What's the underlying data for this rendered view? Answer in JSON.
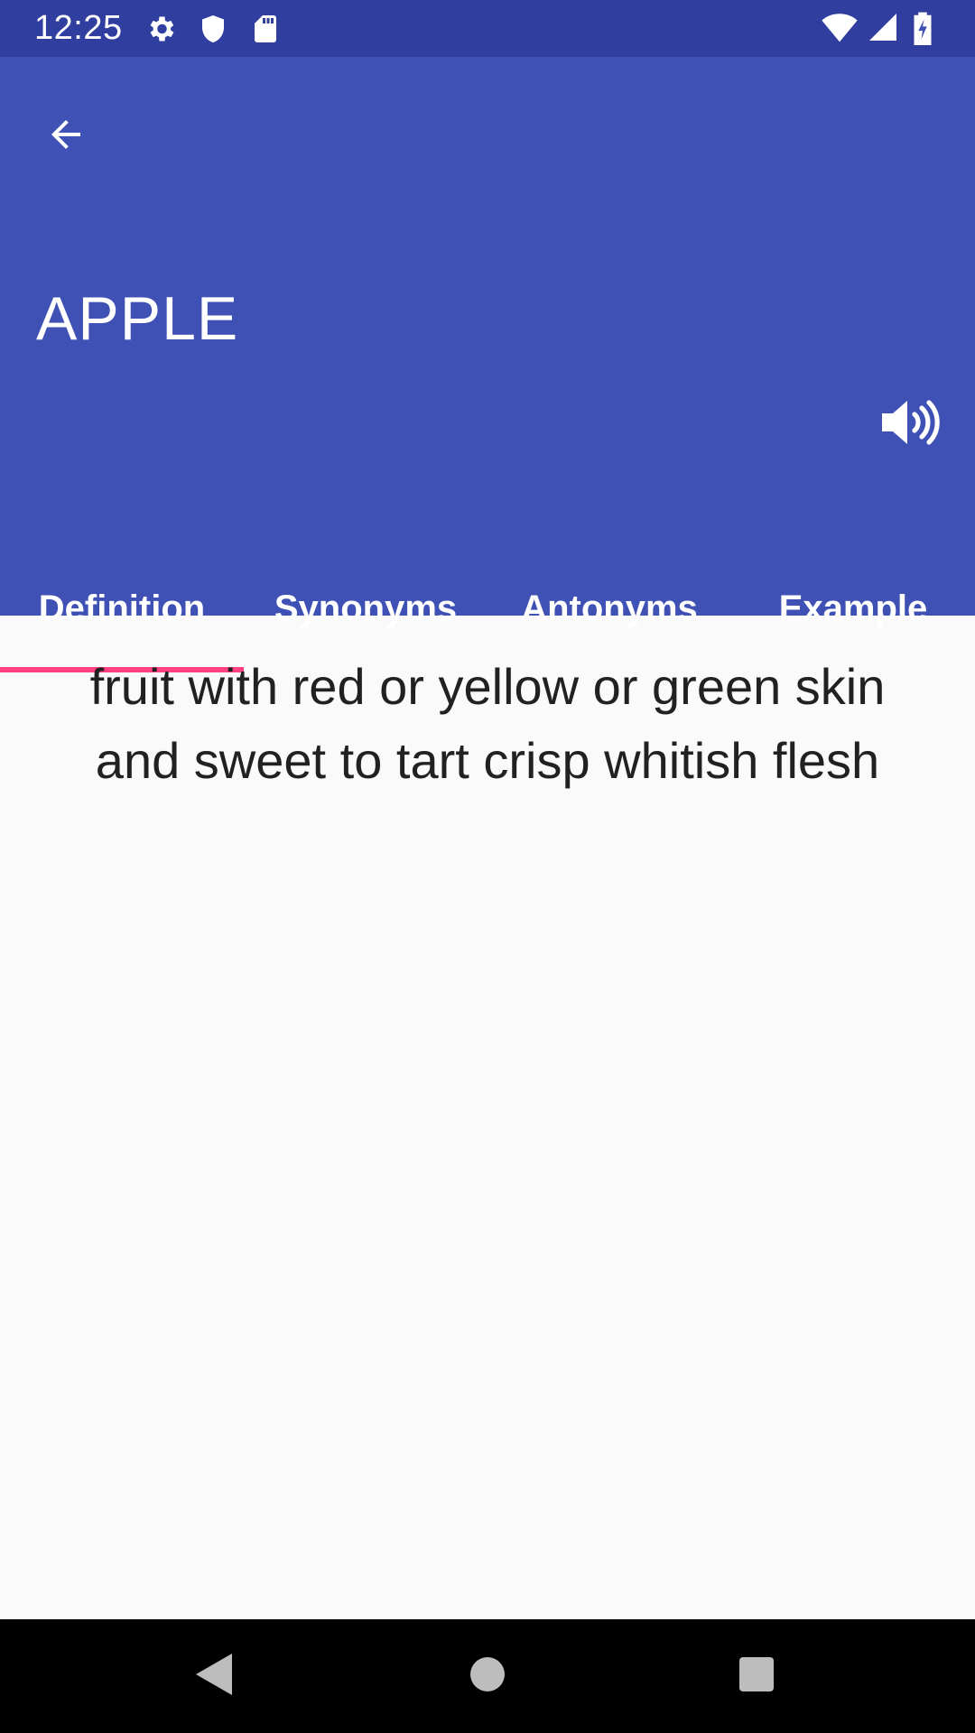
{
  "status_bar": {
    "time": "12:25",
    "icons_left": [
      "settings-icon",
      "shield-icon",
      "sd-card-icon"
    ],
    "icons_right": [
      "wifi-icon",
      "signal-icon",
      "battery-charging-icon"
    ]
  },
  "header": {
    "back_icon": "arrow-left-icon",
    "word": "APPLE",
    "speaker_icon": "speaker-volume-icon"
  },
  "tabs": [
    {
      "label": "Definition",
      "selected": true
    },
    {
      "label": "Synonyms",
      "selected": false
    },
    {
      "label": "Antonyms",
      "selected": false
    },
    {
      "label": "Example",
      "selected": false
    }
  ],
  "content": {
    "definition": "fruit with red or yellow or green skin and sweet to tart crisp whitish flesh"
  },
  "nav_bar": {
    "back_icon": "nav-back-icon",
    "home_icon": "nav-home-icon",
    "recents_icon": "nav-recents-icon"
  },
  "colors": {
    "status_bar": "#303f9f",
    "primary": "#3f51b5",
    "accent": "#ff4081",
    "background": "#fafafa",
    "text": "#212121"
  }
}
